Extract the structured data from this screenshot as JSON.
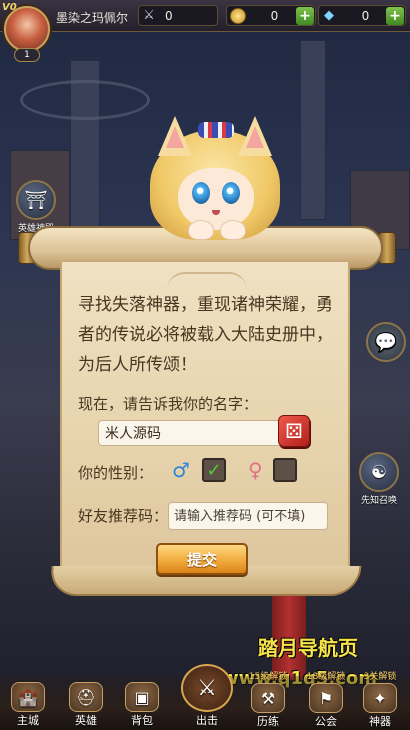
{
  "player": {
    "vip": "V0",
    "name": "墨染之玛佩尔",
    "level": "1"
  },
  "resources": {
    "power": "0",
    "gold": "0",
    "diamond": "0"
  },
  "side_buttons": {
    "hero_hall": "英雄神殿",
    "prophet": "先知召唤"
  },
  "dialog": {
    "intro": "寻找失落神器，重现诸神荣耀，勇者的传说必将被载入大陆史册中，为后人所传颂！",
    "name_prompt": "现在，请告诉我你的名字：",
    "name_value": "米人源码",
    "gender_label": "你的性别：",
    "gender_selected": "male",
    "referral_label": "好友推荐码：",
    "referral_placeholder": "请输入推荐码 (可不填)",
    "submit_label": "提交"
  },
  "watermark": {
    "line1": "踏月导航页",
    "line2": "www.q1q5.com"
  },
  "bottom_nav": [
    {
      "id": "main",
      "label": "主城",
      "lock": ""
    },
    {
      "id": "hero",
      "label": "英雄",
      "lock": ""
    },
    {
      "id": "bag",
      "label": "背包",
      "lock": ""
    },
    {
      "id": "battle",
      "label": "出击",
      "lock": ""
    },
    {
      "id": "train",
      "label": "历练",
      "lock": "15级解锁"
    },
    {
      "id": "guild",
      "label": "公会",
      "lock": "18级解锁"
    },
    {
      "id": "artifact",
      "label": "神器",
      "lock": "3关解锁"
    }
  ],
  "colors": {
    "accent_gold": "#f2ab3d",
    "checkbox_check": "#4ccf3a",
    "watermark": "#f7e44a"
  }
}
